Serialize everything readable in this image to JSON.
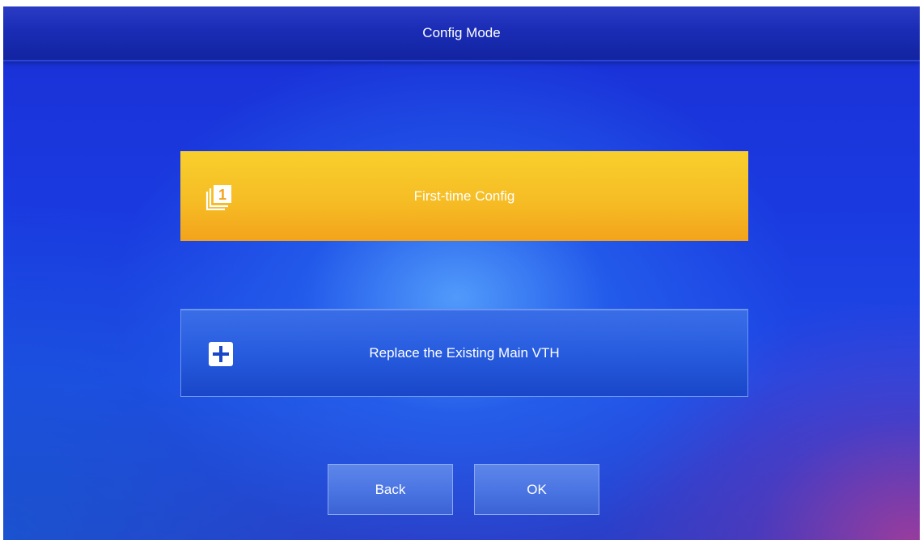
{
  "header": {
    "title": "Config Mode"
  },
  "options": {
    "first_time": {
      "label": "First-time Config",
      "icon": "numbered-layers-icon",
      "icon_number": "1",
      "color": "#f6bd25"
    },
    "replace": {
      "label": "Replace the Existing Main VTH",
      "icon": "plus-box-icon",
      "color": "#275cdf"
    }
  },
  "footer": {
    "back_label": "Back",
    "ok_label": "OK"
  }
}
